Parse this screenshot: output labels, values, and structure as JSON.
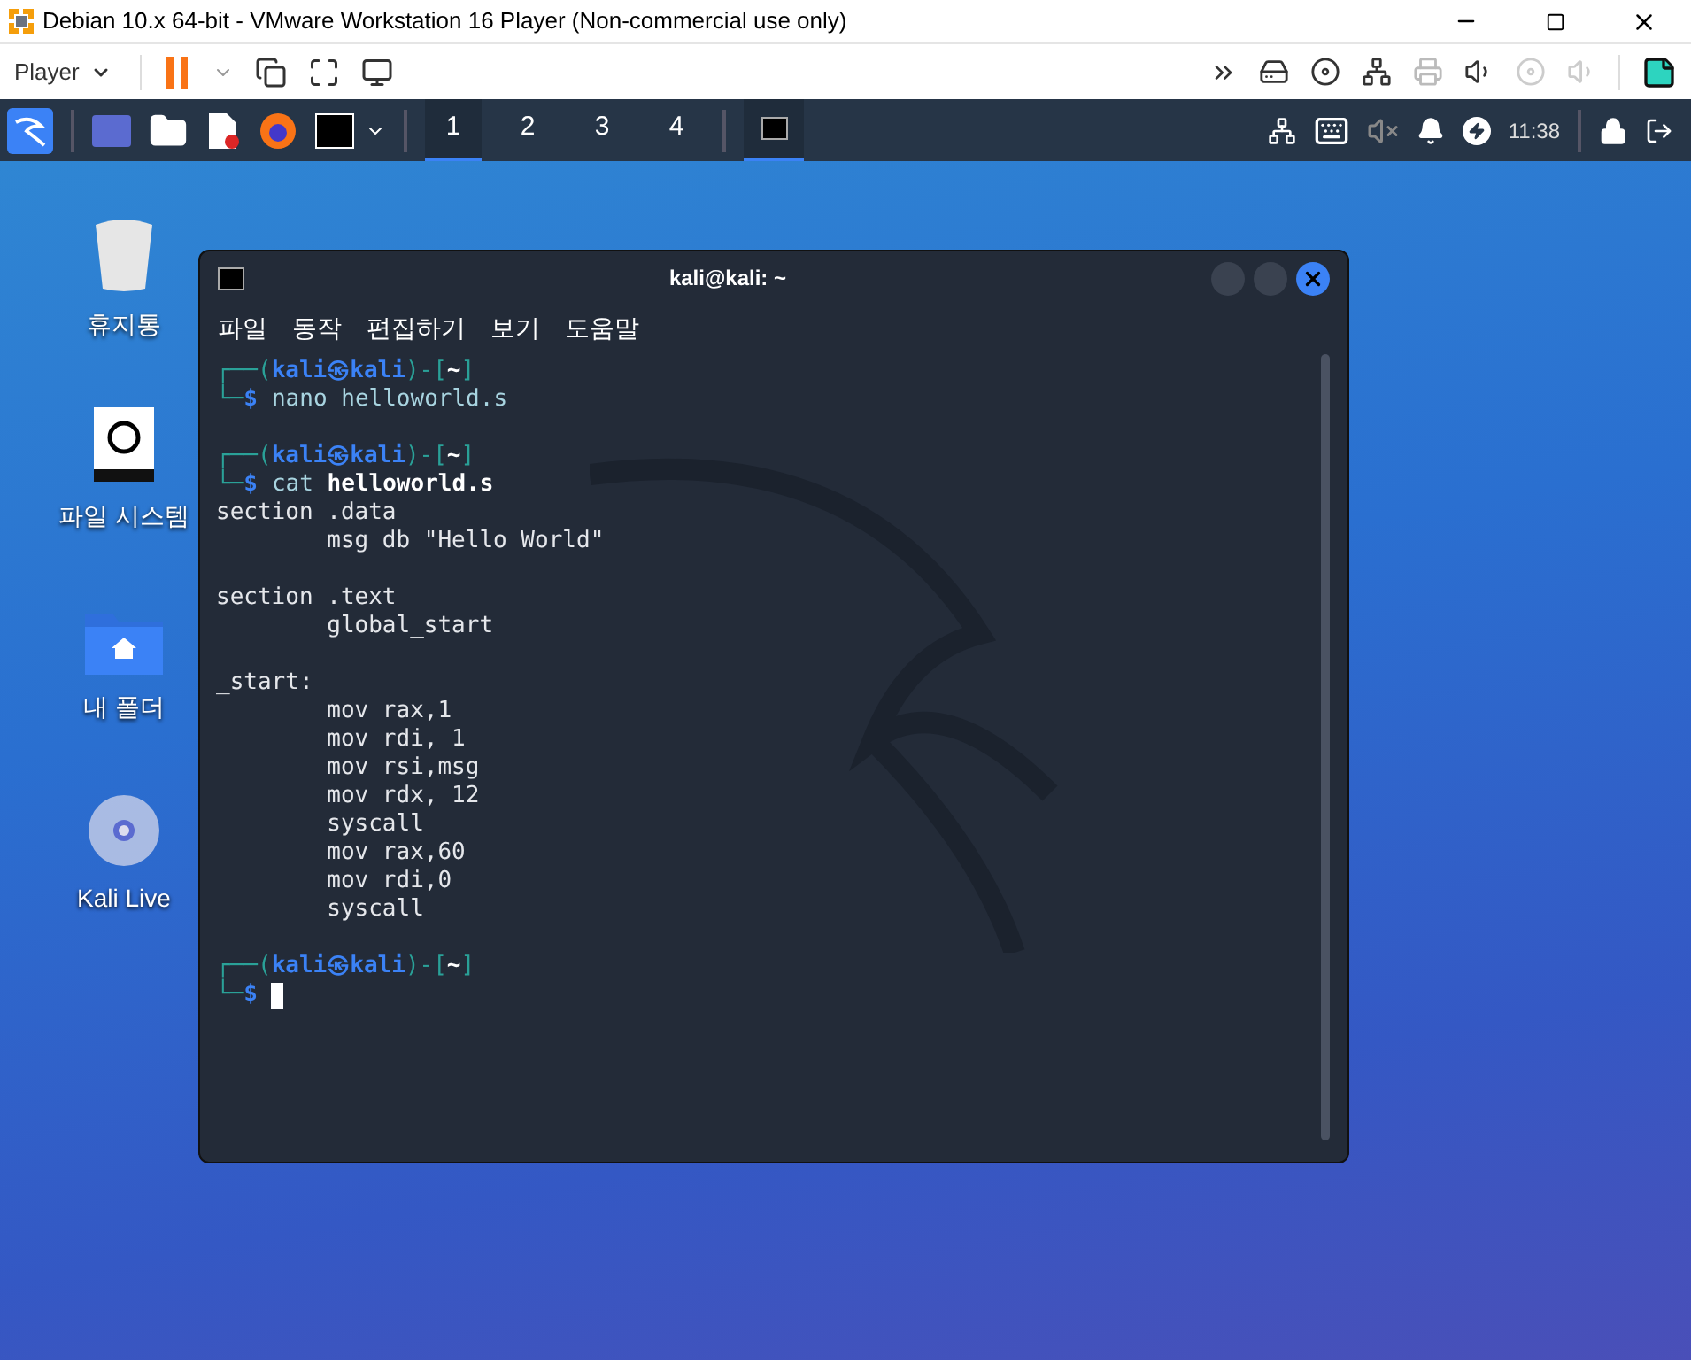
{
  "window": {
    "title": "Debian 10.x 64-bit - VMware Workstation 16 Player (Non-commercial use only)"
  },
  "toolbar": {
    "menu": "Player"
  },
  "taskbar": {
    "workspaces": [
      {
        "label": "1",
        "selected": true
      },
      {
        "label": "2",
        "selected": false
      },
      {
        "label": "3",
        "selected": false
      },
      {
        "label": "4",
        "selected": false
      }
    ],
    "clock": "11:38"
  },
  "desktop_icons": [
    {
      "kind": "trash",
      "label": "휴지통"
    },
    {
      "kind": "drive",
      "label": "파일 시스템"
    },
    {
      "kind": "home",
      "label": "내 폴더"
    },
    {
      "kind": "disc",
      "label": "Kali Live"
    }
  ],
  "terminal": {
    "title": "kali@kali: ~",
    "menu": [
      "파일",
      "동작",
      "편집하기",
      "보기",
      "도움말"
    ],
    "lines": [
      {
        "kind": "prompt",
        "open": "┌──(",
        "user": "kali㉿kali",
        "mid": ")-[",
        "dir": "~",
        "close": "]"
      },
      {
        "kind": "command",
        "corner": "└─",
        "symbol": "$",
        "command": "nano helloworld.s"
      },
      {
        "kind": "blank"
      },
      {
        "kind": "prompt",
        "open": "┌──(",
        "user": "kali㉿kali",
        "mid": ")-[",
        "dir": "~",
        "close": "]"
      },
      {
        "kind": "command",
        "corner": "└─",
        "symbol": "$",
        "command": "cat **helloworld.s**"
      },
      {
        "kind": "output",
        "text": "section .data"
      },
      {
        "kind": "output",
        "text": "        msg db \"Hello World\""
      },
      {
        "kind": "blank"
      },
      {
        "kind": "output",
        "text": "section .text"
      },
      {
        "kind": "output",
        "text": "        global_start"
      },
      {
        "kind": "blank"
      },
      {
        "kind": "output",
        "text": "_start:"
      },
      {
        "kind": "output",
        "text": "        mov rax,1"
      },
      {
        "kind": "output",
        "text": "        mov rdi, 1"
      },
      {
        "kind": "output",
        "text": "        mov rsi,msg"
      },
      {
        "kind": "output",
        "text": "        mov rdx, 12"
      },
      {
        "kind": "output",
        "text": "        syscall"
      },
      {
        "kind": "output",
        "text": "        mov rax,60"
      },
      {
        "kind": "output",
        "text": "        mov rdi,0"
      },
      {
        "kind": "output",
        "text": "        syscall"
      },
      {
        "kind": "blank"
      },
      {
        "kind": "prompt",
        "open": "┌──(",
        "user": "kali㉿kali",
        "mid": ")-[",
        "dir": "~",
        "close": "]"
      },
      {
        "kind": "command",
        "corner": "└─",
        "symbol": "$",
        "cursor": true
      }
    ]
  }
}
